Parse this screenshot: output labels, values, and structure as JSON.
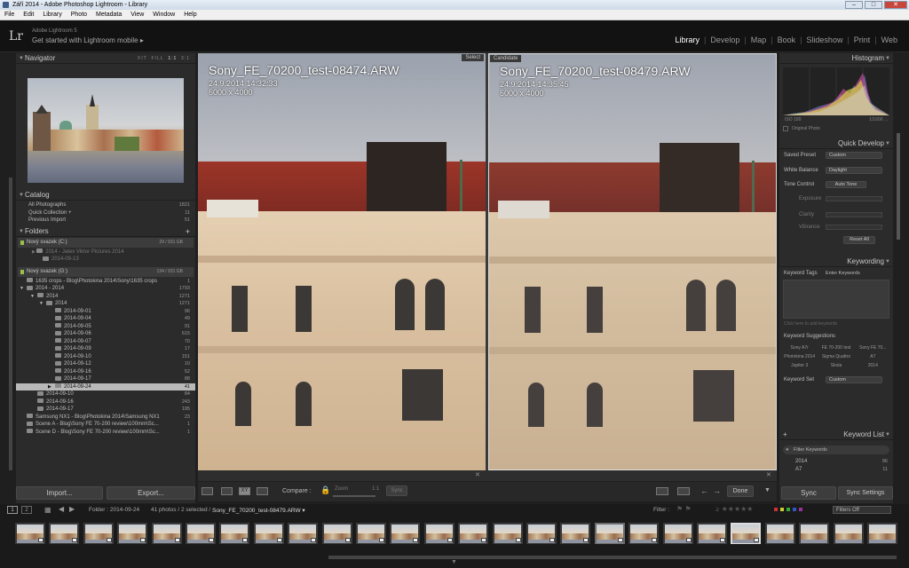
{
  "window": {
    "title": "Září 2014 - Adobe Photoshop Lightroom - Library"
  },
  "menu": [
    "File",
    "Edit",
    "Library",
    "Photo",
    "Metadata",
    "View",
    "Window",
    "Help"
  ],
  "identity": {
    "logo": "Lr",
    "line1": "Adobe Lightroom 5",
    "line2": "Get started with Lightroom mobile ▸"
  },
  "modules": [
    "Library",
    "Develop",
    "Map",
    "Book",
    "Slideshow",
    "Print",
    "Web"
  ],
  "navigator": {
    "title": "Navigator",
    "zoom": [
      "FIT",
      "FILL",
      "1:1",
      "3:1"
    ]
  },
  "catalog": {
    "title": "Catalog",
    "items": [
      {
        "label": "All Photographs",
        "count": "1821"
      },
      {
        "label": "Quick Collection +",
        "count": "11"
      },
      {
        "label": "Previous Import",
        "count": "51"
      }
    ]
  },
  "folders": {
    "title": "Folders",
    "plus": "+",
    "drives": [
      {
        "label": "Nový svazek (C:)",
        "size": "29 / 931 GB"
      },
      {
        "label": "Nový svazek (G:)",
        "size": "134 / 931 GB"
      }
    ],
    "c_items": [
      {
        "label": "2014 - Jatex Viktor Pictures 2014",
        "count": ""
      },
      {
        "label": "2014-09-13",
        "count": ""
      }
    ],
    "items": [
      {
        "label": "1635 crops - Blog\\Photokina 2014\\Sony\\1635 crops",
        "count": "1"
      },
      {
        "label": "2014 - 2014",
        "count": "1793"
      },
      {
        "label": "2014",
        "count": "1271"
      },
      {
        "label": "2014",
        "count": "1271"
      },
      {
        "label": "2014-09-01",
        "count": "96"
      },
      {
        "label": "2014-09-04",
        "count": "49"
      },
      {
        "label": "2014-09-05",
        "count": "91"
      },
      {
        "label": "2014-09-06",
        "count": "615"
      },
      {
        "label": "2014-09-07",
        "count": "70"
      },
      {
        "label": "2014-09-09",
        "count": "17"
      },
      {
        "label": "2014-09-10",
        "count": "151"
      },
      {
        "label": "2014-09-12",
        "count": "10"
      },
      {
        "label": "2014-09-16",
        "count": "52"
      },
      {
        "label": "2014-09-17",
        "count": "88"
      },
      {
        "label": "2014-09-24",
        "count": "41"
      },
      {
        "label": "2014-09-10",
        "count": "84"
      },
      {
        "label": "2014-09-16",
        "count": "243"
      },
      {
        "label": "2014-09-17",
        "count": "195"
      },
      {
        "label": "Samsung NX1 - Blog\\Photokina 2014\\Samsung NX1",
        "count": "23"
      },
      {
        "label": "Scene A - Blog\\Sony FE 70-200 review\\100mm\\Sc...",
        "count": "1"
      },
      {
        "label": "Scene D - Blog\\Sony FE 70-200 review\\100mm\\Sc...",
        "count": "1"
      }
    ]
  },
  "left_buttons": {
    "import": "Import...",
    "export": "Export..."
  },
  "select": {
    "label": "Select",
    "name": "Sony_FE_70200_test-08474.ARW",
    "date": "24.9.2014 14:32:33",
    "dims": "6000 x 4000"
  },
  "candidate": {
    "label": "Candidate",
    "name": "Sony_FE_70200_test-08479.ARW",
    "date": "24.9.2014 14:35:45",
    "dims": "6000 x 4000"
  },
  "toolbar": {
    "compare": "Compare :",
    "zoom": "Zoom",
    "ratio": "1:1",
    "sync": "Sync",
    "done": "Done"
  },
  "histogram": {
    "title": "Histogram",
    "iso": "ISO 100",
    "shutter": "1/1600 ...",
    "original": "Original Photo"
  },
  "quick_develop": {
    "title": "Quick Develop",
    "saved_preset_label": "Saved Preset",
    "saved_preset": "Custom",
    "wb_label": "White Balance",
    "wb": "Daylight",
    "tone_label": "Tone Control",
    "auto_tone": "Auto Tone",
    "exposure": "Exposure",
    "clarity": "Clarity",
    "vibrance": "Vibrance",
    "reset": "Reset All"
  },
  "keywording": {
    "title": "Keywording",
    "tags_label": "Keyword Tags",
    "tags_value": "Enter Keywords",
    "click_here": "Click here to add keywords",
    "suggestions": "Keyword Suggestions",
    "sugg": [
      "Sony A7r",
      "FE 70-200 test",
      "Sony FE 70...",
      "Photokina 2014",
      "Sigma Quattro",
      "A7",
      "Jupiter 3",
      "Skola",
      "2014"
    ],
    "set_label": "Keyword Set",
    "set_value": "Custom"
  },
  "keyword_list": {
    "title": "Keyword List",
    "filter": "Filter Keywords",
    "items": [
      {
        "label": "2014",
        "count": "96"
      },
      {
        "label": "A7",
        "count": "11"
      }
    ]
  },
  "right_buttons": {
    "sync": "Sync",
    "sync_settings": "Sync Settings"
  },
  "filmbar": {
    "pages": [
      "1",
      "2"
    ],
    "path": "Folder : 2014-09-24",
    "count": "41 photos / 2 selected /",
    "file": "Sony_FE_70200_test-08479.ARW ▾",
    "filter": "Filter :",
    "filters_off": "Filters Off"
  }
}
